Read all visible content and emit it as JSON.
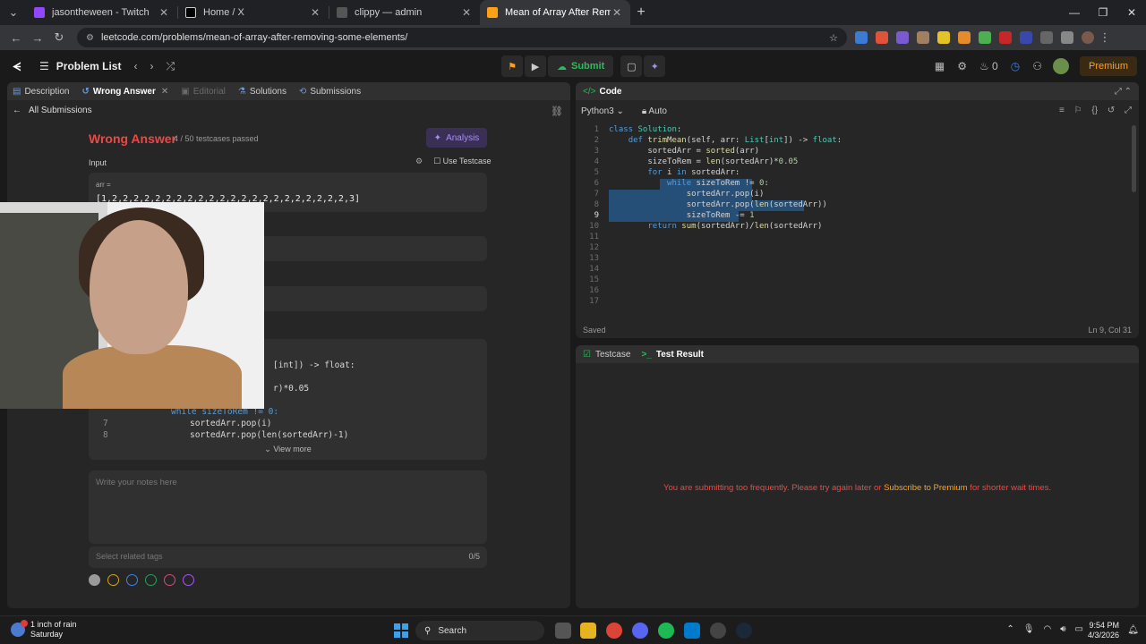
{
  "browser": {
    "tabs": [
      {
        "title": "jasontheween - Twitch",
        "fav_color": "#9146ff",
        "icon": "twitch-icon"
      },
      {
        "title": "Home / X",
        "fav_color": "#ffffff",
        "icon": "x-icon"
      },
      {
        "title": "clippy — admin",
        "fav_color": "#888888",
        "icon": "clippy-icon"
      },
      {
        "title": "Mean of Array After Removing",
        "fav_color": "#ffa116",
        "icon": "leetcode-icon"
      }
    ],
    "new_tab": "+",
    "url": "leetcode.com/problems/mean-of-array-after-removing-some-elements/"
  },
  "header": {
    "problem_list": "Problem List",
    "submit": "Submit",
    "premium": "Premium",
    "streak_count": "0"
  },
  "left": {
    "tabs": [
      {
        "label": "Description",
        "state": "normal",
        "icon": "description-icon"
      },
      {
        "label": "Wrong Answer",
        "state": "active",
        "icon": "wrong-answer-icon"
      },
      {
        "label": "Editorial",
        "state": "dim",
        "icon": "editorial-icon"
      },
      {
        "label": "Solutions",
        "state": "normal",
        "icon": "solutions-icon"
      },
      {
        "label": "Submissions",
        "state": "normal",
        "icon": "submissions-icon"
      }
    ],
    "all_submissions": "All Submissions",
    "result_title": "Wrong Answer",
    "testcases": "4 / 50 testcases passed",
    "analysis": "Analysis",
    "input_label": "Input",
    "use_testcase": "Use Testcase",
    "arr_label": "arr =",
    "arr_value": "[1,2,2,2,2,2,2,2,2,2,2,2,2,2,2,2,2,2,2,2,2,2,2,3]",
    "code_snippet": {
      "line1_tail": "[int]) -> float:",
      "line2_tail": "r)*0.05",
      "line6_partial": "while sizeToRem != 0:",
      "line7_num": "7",
      "line7": "sortedArr.pop(i)",
      "line8_num": "8",
      "line8": "sortedArr.pop(len(sortedArr)-1)"
    },
    "view_more": "View more",
    "notes_placeholder": "Write your notes here",
    "tags_placeholder": "Select related tags",
    "tags_count": "0/5",
    "tag_colors": [
      "#9a9a9a",
      "#d4a017",
      "#3b82f6",
      "#22a055",
      "#e0457b",
      "#a855f7"
    ]
  },
  "code": {
    "title": "Code",
    "language": "Python3",
    "mode": "Auto",
    "lines": [
      {
        "n": "1",
        "text": "class Solution:"
      },
      {
        "n": "2",
        "text": "    def trimMean(self, arr: List[int]) -> float:"
      },
      {
        "n": "3",
        "text": "        sortedArr = sorted(arr)"
      },
      {
        "n": "4",
        "text": "        sizeToRem = len(sortedArr)*0.05"
      },
      {
        "n": "5",
        "text": "        for i in sortedArr:"
      },
      {
        "n": "6",
        "text": "            while sizeToRem != 0:"
      },
      {
        "n": "7",
        "text": "                sortedArr.pop(i)"
      },
      {
        "n": "8",
        "text": "                sortedArr.pop(len(sortedArr))"
      },
      {
        "n": "9",
        "text": "                sizeToRem -= 1"
      },
      {
        "n": "10",
        "text": "        return sum(sortedArr)/len(sortedArr)"
      },
      {
        "n": "11",
        "text": ""
      },
      {
        "n": "12",
        "text": ""
      },
      {
        "n": "13",
        "text": ""
      },
      {
        "n": "14",
        "text": ""
      },
      {
        "n": "15",
        "text": ""
      },
      {
        "n": "16",
        "text": ""
      },
      {
        "n": "17",
        "text": ""
      }
    ],
    "saved": "Saved",
    "cursor": "Ln 9, Col 31"
  },
  "result": {
    "tab_testcase": "Testcase",
    "tab_result": "Test Result",
    "msg_prefix": "You are submitting too frequently. Please try again later or ",
    "msg_link": "Subscribe to Premium",
    "msg_suffix": " for shorter wait times."
  },
  "taskbar": {
    "weather_line1": "1 inch of rain",
    "weather_line2": "Saturday",
    "search": "Search",
    "time": "9:54 PM",
    "date": "4/3/2026"
  }
}
